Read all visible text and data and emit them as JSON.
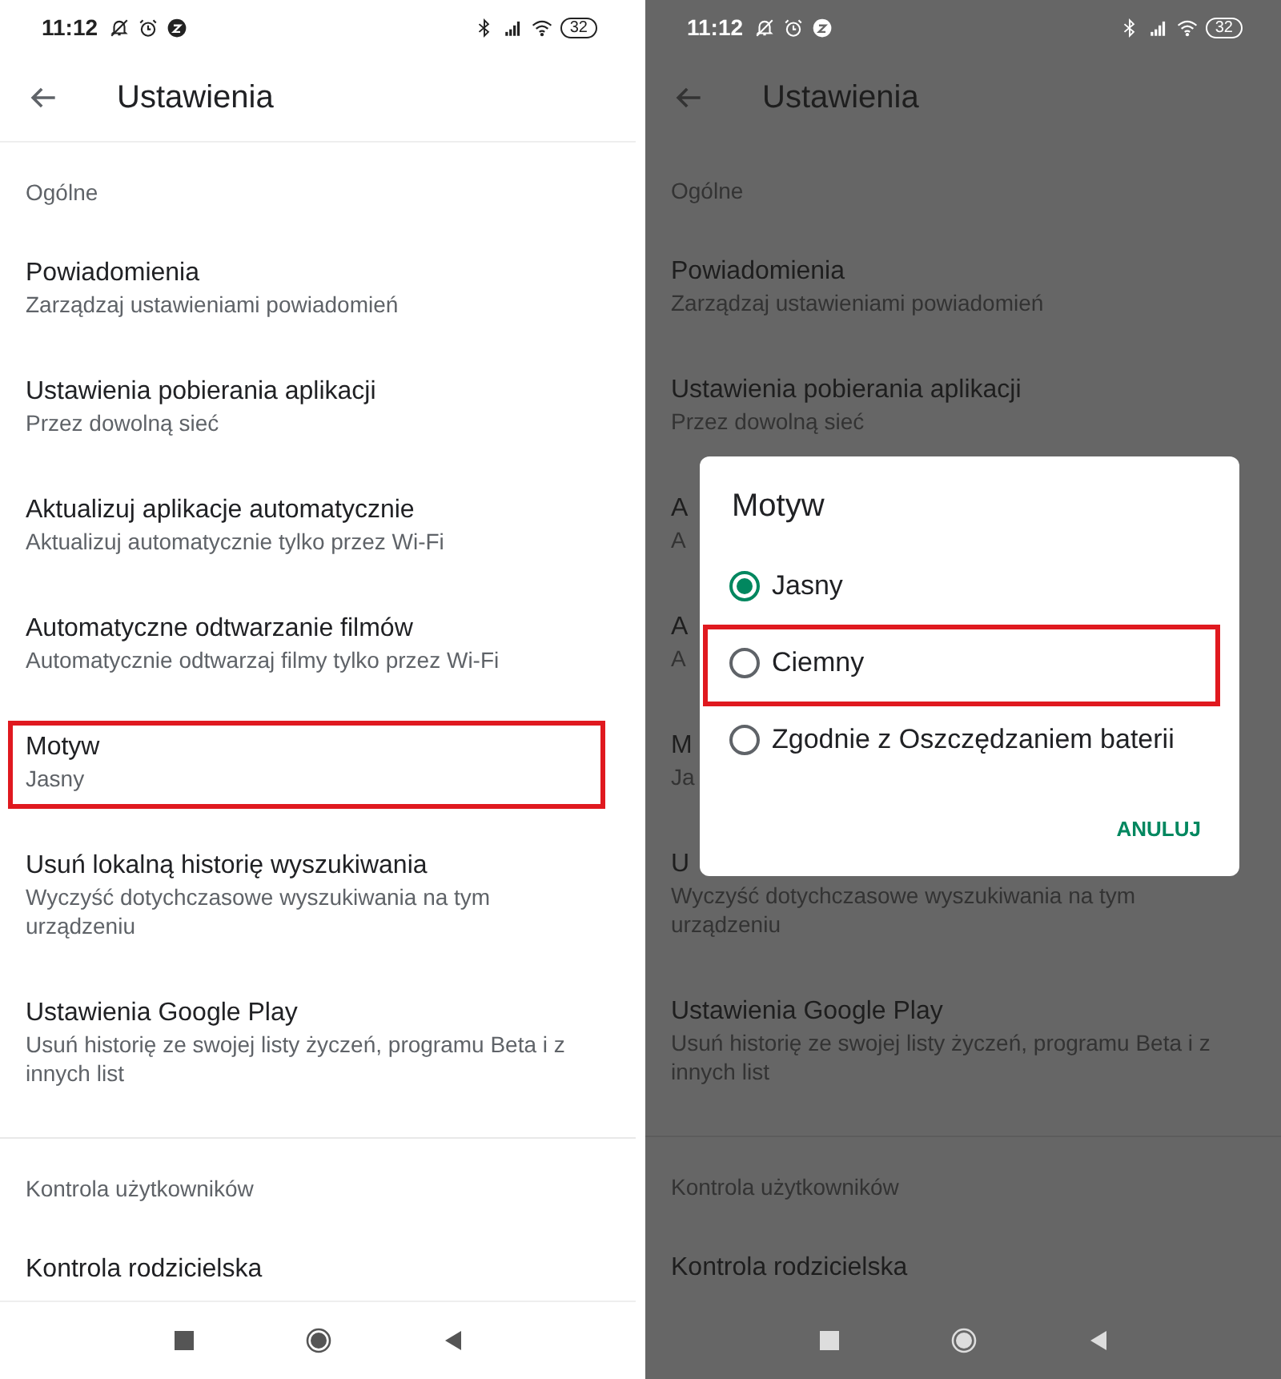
{
  "panels": [
    {
      "dimmed": false,
      "status_bar": {
        "time": "11:12",
        "battery": "32"
      },
      "toolbar": {
        "title": "Ustawienia"
      },
      "sections": [
        {
          "header": "Ogólne",
          "items": [
            {
              "title": "Powiadomienia",
              "subtitle": "Zarządzaj ustawieniami powiadomień",
              "highlighted": false
            },
            {
              "title": "Ustawienia pobierania aplikacji",
              "subtitle": "Przez dowolną sieć",
              "highlighted": false
            },
            {
              "title": "Aktualizuj aplikacje automatycznie",
              "subtitle": "Aktualizuj automatycznie tylko przez Wi-Fi",
              "highlighted": false
            },
            {
              "title": "Automatyczne odtwarzanie filmów",
              "subtitle": "Automatycznie odtwarzaj filmy tylko przez Wi-Fi",
              "highlighted": false
            },
            {
              "title": "Motyw",
              "subtitle": "Jasny",
              "highlighted": true
            },
            {
              "title": "Usuń lokalną historię wyszukiwania",
              "subtitle": "Wyczyść dotychczasowe wyszukiwania na tym urządzeniu",
              "highlighted": false
            },
            {
              "title": "Ustawienia Google Play",
              "subtitle": "Usuń historię ze swojej listy życzeń, programu Beta i z innych list",
              "highlighted": false
            }
          ]
        },
        {
          "header": "Kontrola użytkowników",
          "items": [
            {
              "title": "Kontrola rodzicielska",
              "highlighted": false
            }
          ]
        }
      ]
    },
    {
      "dimmed": true,
      "status_bar": {
        "time": "11:12",
        "battery": "32"
      },
      "toolbar": {
        "title": "Ustawienia"
      },
      "sections": [
        {
          "header": "Ogólne",
          "items": [
            {
              "title": "Powiadomienia",
              "subtitle": "Zarządzaj ustawieniami powiadomień",
              "highlighted": false
            },
            {
              "title": "Ustawienia pobierania aplikacji",
              "subtitle": "Przez dowolną sieć",
              "highlighted": false
            },
            {
              "title": "A",
              "subtitle": "A",
              "highlighted": false
            },
            {
              "title": "A",
              "subtitle": "A",
              "highlighted": false
            },
            {
              "title": "M",
              "subtitle": "Ja",
              "highlighted": false
            },
            {
              "title": "U",
              "subtitle": "Wyczyść dotychczasowe wyszukiwania na tym urządzeniu",
              "highlighted": false
            },
            {
              "title": "Ustawienia Google Play",
              "subtitle": "Usuń historię ze swojej listy życzeń, programu Beta i z innych list",
              "highlighted": false
            }
          ]
        },
        {
          "header": "Kontrola użytkowników",
          "items": [
            {
              "title": "Kontrola rodzicielska",
              "highlighted": false
            }
          ]
        }
      ],
      "dialog": {
        "title": "Motyw",
        "options": [
          {
            "label": "Jasny",
            "selected": true,
            "highlighted": false
          },
          {
            "label": "Ciemny",
            "selected": false,
            "highlighted": true
          },
          {
            "label": "Zgodnie z Oszczędzaniem baterii",
            "selected": false,
            "highlighted": false
          }
        ],
        "button": "ANULUJ"
      }
    }
  ]
}
